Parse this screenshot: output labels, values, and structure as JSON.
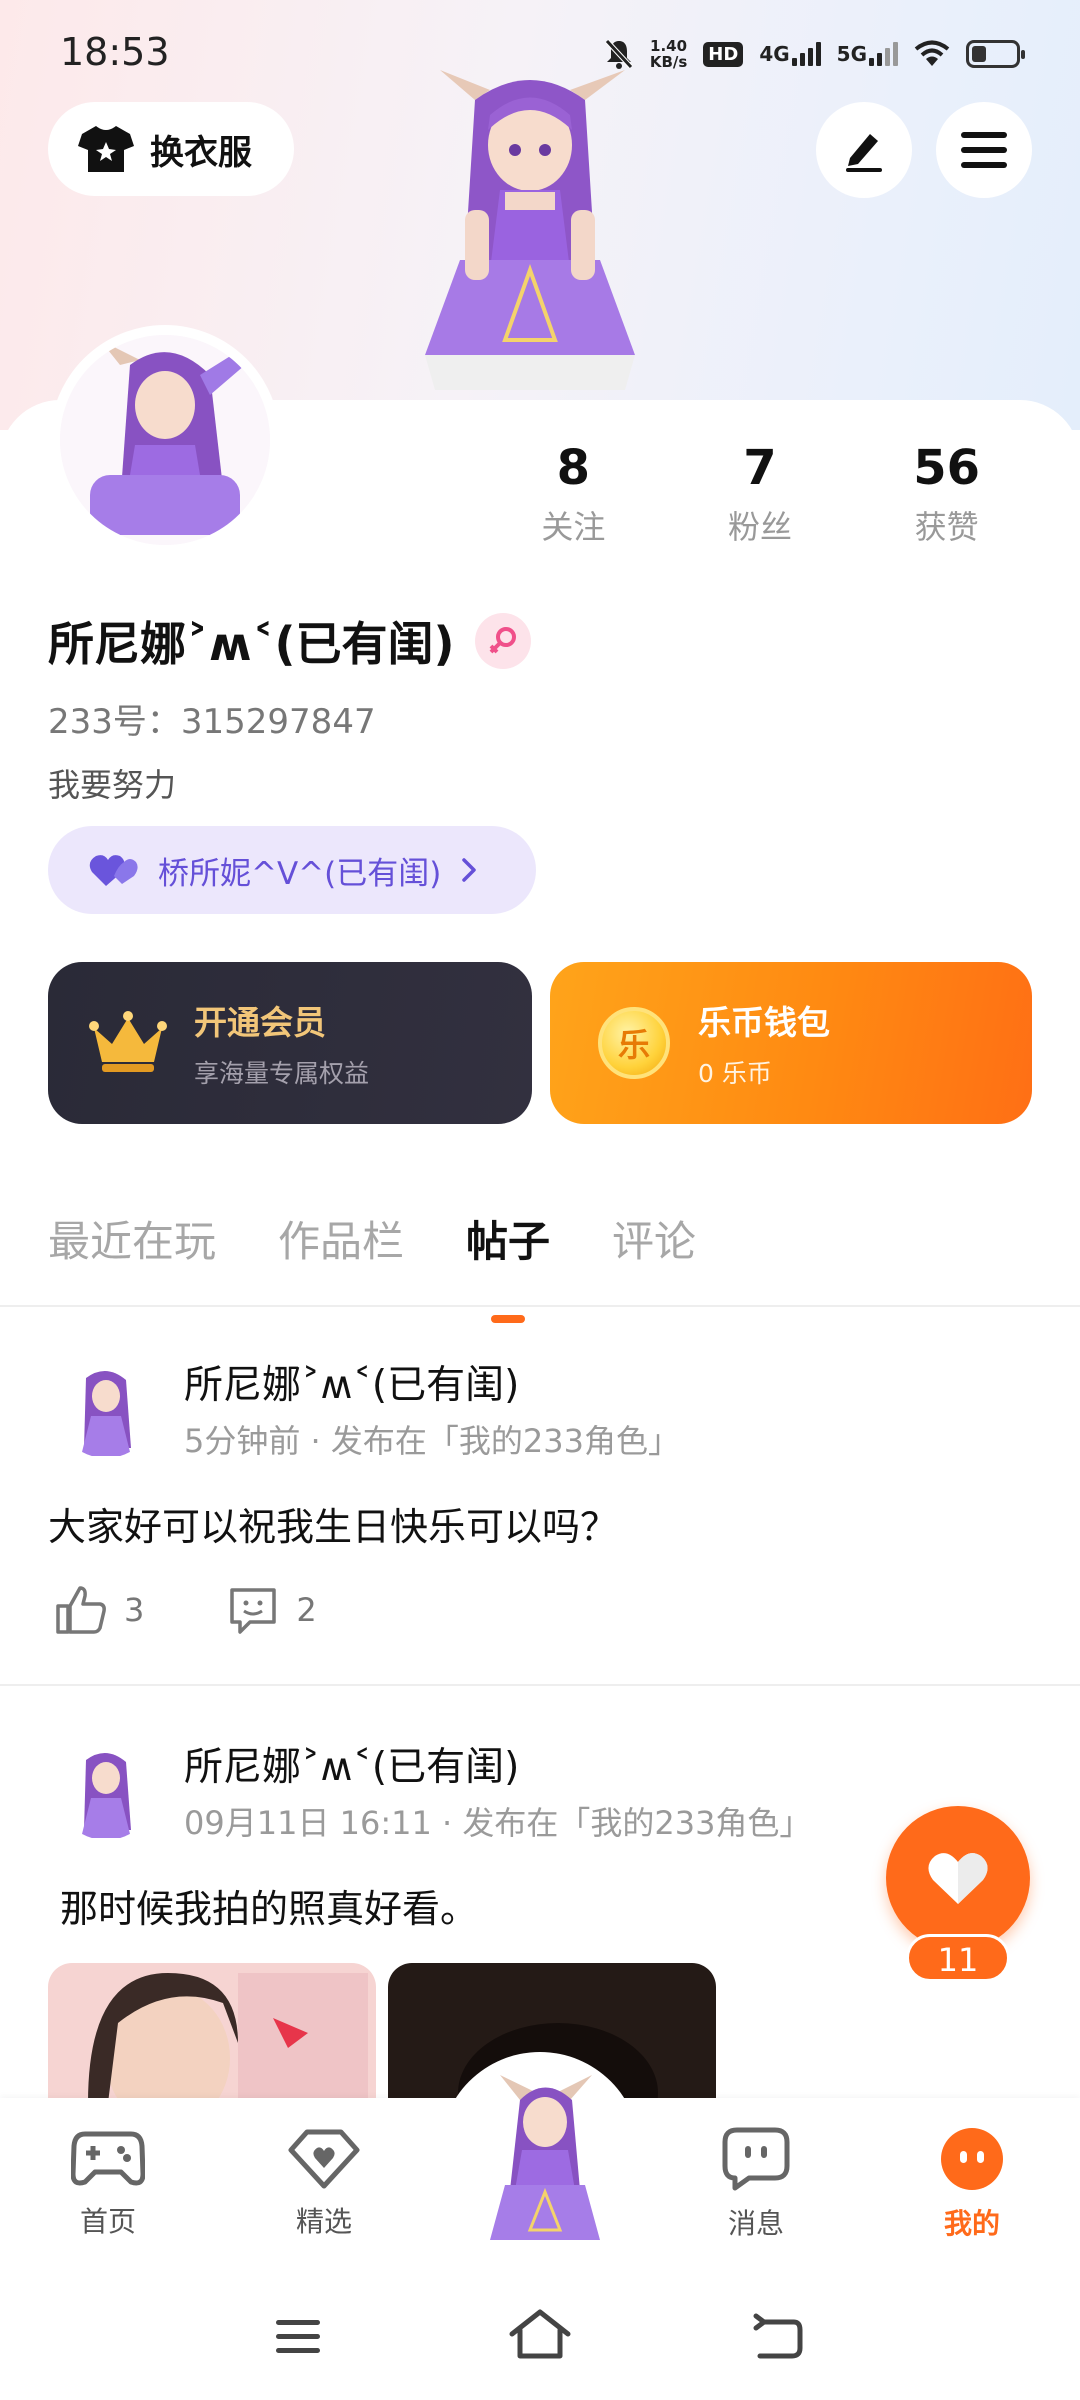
{
  "status_bar": {
    "time": "18:53",
    "net_speed_top": "1.40",
    "net_speed_bottom": "KB/s",
    "hd": "HD",
    "net_4g": "4G",
    "net_5g": "5G"
  },
  "header": {
    "outfit_button": "换衣服"
  },
  "profile": {
    "stats": [
      {
        "num": "8",
        "label": "关注"
      },
      {
        "num": "7",
        "label": "粉丝"
      },
      {
        "num": "56",
        "label": "获赞"
      }
    ],
    "username": "所尼娜˃ʍ˂(已有闺)",
    "uid": "233号：315297847",
    "bio": "我要努力",
    "relation": "桥所妮^V^(已有闺)"
  },
  "cards": {
    "vip_title": "开通会员",
    "vip_sub": "享海量专属权益",
    "wallet_title": "乐币钱包",
    "wallet_sub": "0 乐币",
    "coin_glyph": "乐"
  },
  "tabs": [
    "最近在玩",
    "作品栏",
    "帖子",
    "评论"
  ],
  "active_tab": "帖子",
  "posts": [
    {
      "author": "所尼娜˃ʍ˂(已有闺)",
      "meta": "5分钟前 · 发布在「我的233角色」",
      "text": "大家好可以祝我生日快乐可以吗？",
      "likes": "3",
      "comments": "2"
    },
    {
      "author": "所尼娜˃ʍ˂(已有闺)",
      "meta": "09月11日 16:11 · 发布在「我的233角色」",
      "text": "那时候我拍的照真好看。"
    }
  ],
  "like_fab_count": "11",
  "bottom_nav": [
    {
      "label": "首页",
      "icon": "gamepad-icon"
    },
    {
      "label": "精选",
      "icon": "heart-shield-icon"
    },
    {
      "label": "消息",
      "icon": "chat-bubble-icon"
    },
    {
      "label": "我的",
      "icon": "face-icon"
    }
  ],
  "colors": {
    "accent": "#ff6a1a",
    "vip_gold": "#f2c679",
    "relation_purple": "#6550d8"
  }
}
